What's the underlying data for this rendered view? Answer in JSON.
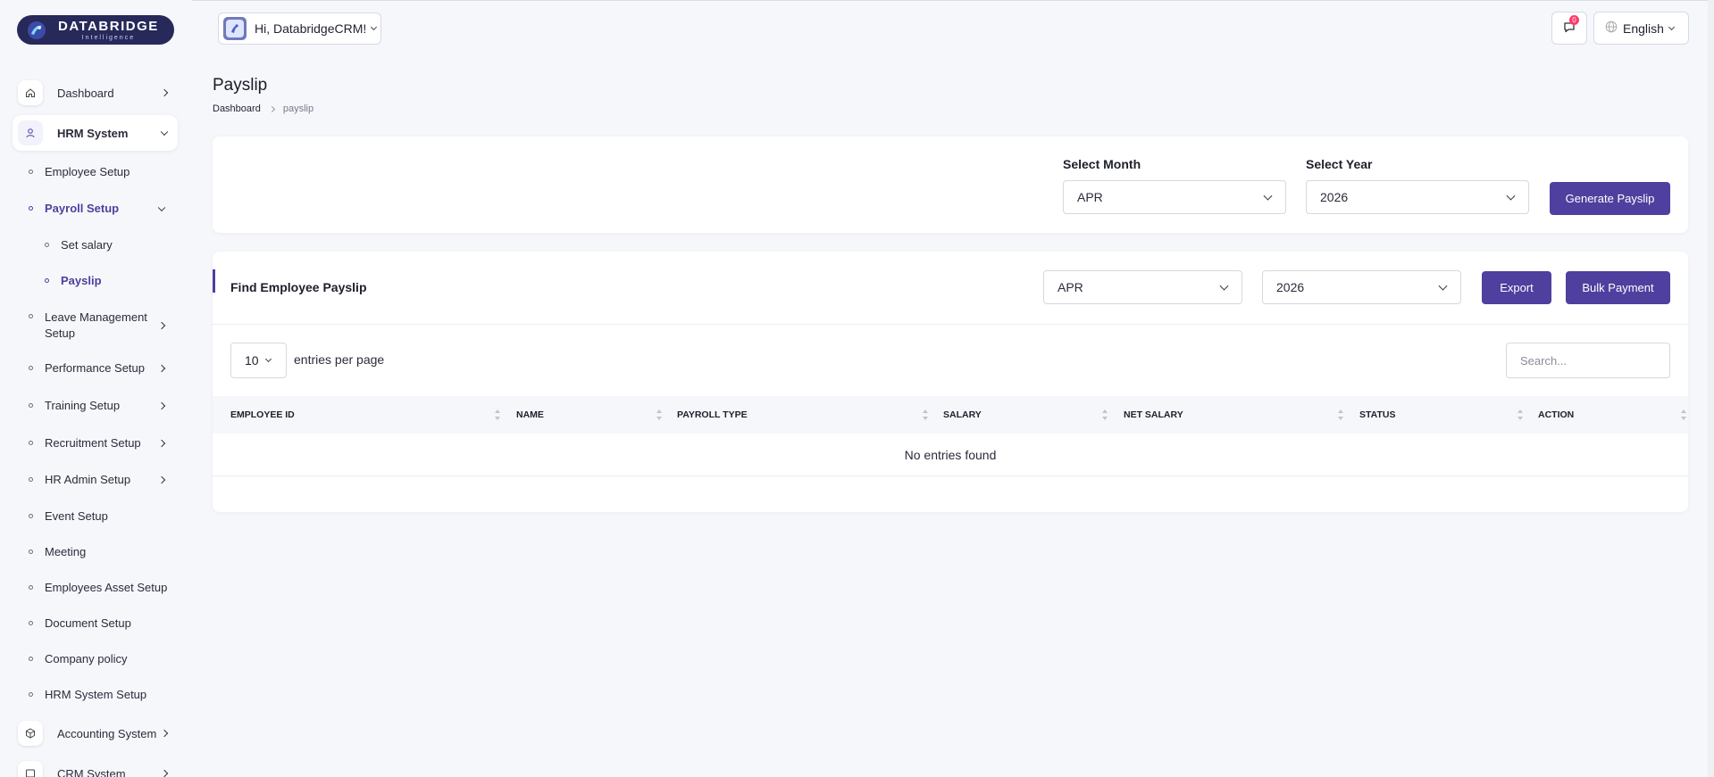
{
  "brand": {
    "name": "DATABRIDGE",
    "tagline": "Intelligence"
  },
  "header": {
    "user_greeting": "Hi, DatabridgeCRM!",
    "notification_count": "0",
    "language": "English"
  },
  "sidebar": {
    "dashboard": "Dashboard",
    "hrm_system": "HRM System",
    "employee_setup": "Employee Setup",
    "payroll_setup": "Payroll Setup",
    "set_salary": "Set salary",
    "payslip": "Payslip",
    "leave_management_1": "Leave Management",
    "leave_management_2": "Setup",
    "performance_setup": "Performance Setup",
    "training_setup": "Training Setup",
    "recruitment_setup": "Recruitment Setup",
    "hr_admin_setup": "HR Admin Setup",
    "event_setup": "Event Setup",
    "meeting": "Meeting",
    "employees_asset_setup": "Employees Asset Setup",
    "document_setup": "Document Setup",
    "company_policy": "Company policy",
    "hrm_system_setup": "HRM System Setup",
    "accounting_system": "Accounting System",
    "crm_system": "CRM System"
  },
  "page": {
    "title": "Payslip",
    "breadcrumb_home": "Dashboard",
    "breadcrumb_current": "payslip"
  },
  "generate": {
    "month_label": "Select Month",
    "month_value": "APR",
    "year_label": "Select Year",
    "year_value": "2026",
    "button": "Generate Payslip"
  },
  "find": {
    "title": "Find Employee Payslip",
    "month_value": "APR",
    "year_value": "2026",
    "export_button": "Export",
    "bulk_button": "Bulk Payment",
    "entries_value": "10",
    "entries_label": "entries per page",
    "search_placeholder": "Search..."
  },
  "table": {
    "columns": [
      "EMPLOYEE ID",
      "NAME",
      "PAYROLL TYPE",
      "SALARY",
      "NET SALARY",
      "STATUS",
      "ACTION"
    ],
    "empty_text": "No entries found"
  },
  "colors": {
    "accent": "#4f3f9e",
    "badge": "#ff3a6e",
    "background": "#f6f7fb"
  }
}
